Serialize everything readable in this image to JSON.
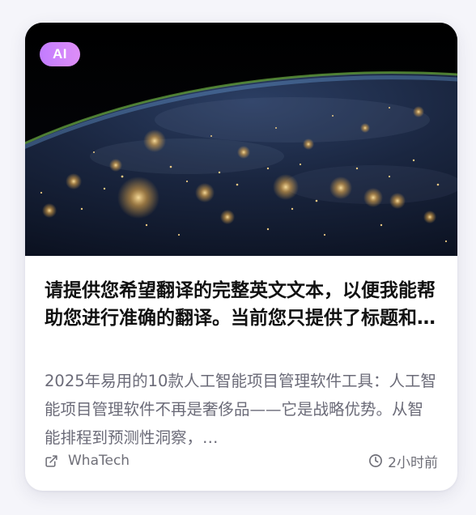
{
  "card": {
    "badge": "AI",
    "image_alt": "Earth at night from space with city lights",
    "title": "请提供您希望翻译的完整英文文本，以便我能帮助您进行准确的翻译。当前您只提供了标题和部分内容。",
    "excerpt": "2025年易用的10款人工智能项目管理软件工具：人工智能项目管理软件不再是奢侈品——它是战略优势。从智能排程到预测性洞察，…",
    "source": "WhaTech",
    "time": "2小时前"
  },
  "colors": {
    "badge_gradient_start": "#c27cff",
    "badge_gradient_end": "#de8ef7",
    "title": "#111111",
    "excerpt": "#6b6b78",
    "meta": "#6f6f78"
  },
  "icons": {
    "source": "external-link-icon",
    "time": "clock-icon"
  }
}
